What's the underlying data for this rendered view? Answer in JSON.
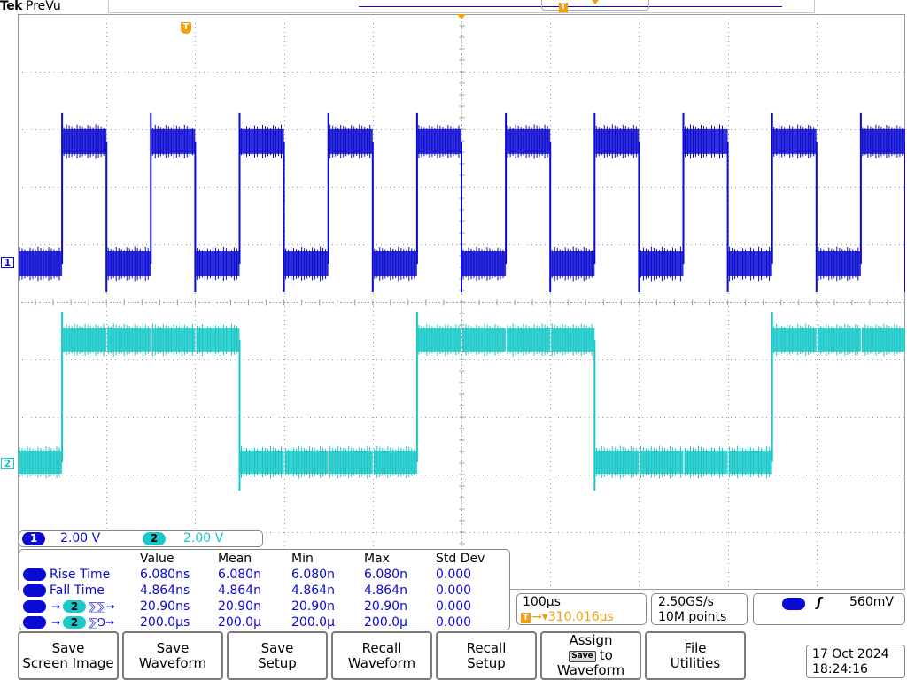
{
  "header": {
    "brand": "Tek",
    "mode": "PreVu"
  },
  "markers": {
    "trigger_glyph": "T",
    "ch1_ground": "1",
    "ch2_ground": "2"
  },
  "colors": {
    "ch1": "#0a0ad2",
    "ch2": "#19c8c8",
    "trigger": "#f0a010",
    "grid": "#9a9a9a"
  },
  "channels": [
    {
      "label": "1",
      "scale": "2.00 V"
    },
    {
      "label": "2",
      "scale": "2.00 V"
    }
  ],
  "measurements": {
    "headers": [
      "Value",
      "Mean",
      "Min",
      "Max",
      "Std Dev"
    ],
    "rows": [
      {
        "name": "Rise Time",
        "value": "6.080ns",
        "mean": "6.080n",
        "min": "6.080n",
        "max": "6.080n",
        "std": "0.000"
      },
      {
        "name": "Fall Time",
        "value": "4.864ns",
        "mean": "4.864n",
        "min": "4.864n",
        "max": "4.864n",
        "std": "0.000"
      },
      {
        "name": "Delay 1→2 (rising→rising)",
        "src": "1",
        "dst": "2",
        "arrow": "→",
        "edge": "⅀⅀→",
        "value": "20.90ns",
        "mean": "20.90n",
        "min": "20.90n",
        "max": "20.90n",
        "std": "0.000"
      },
      {
        "name": "Delay 1→2 (rising→falling)",
        "src": "1",
        "dst": "2",
        "arrow": "→",
        "edge": "⅀⅁→",
        "value": "200.0µs",
        "mean": "200.0µ",
        "min": "200.0µ",
        "max": "200.0µ",
        "std": "0.000"
      }
    ]
  },
  "horizontal": {
    "time_per_div": "100µs",
    "trigger_position": "→▾310.016µs"
  },
  "acquisition": {
    "sample_rate": "2.50GS/s",
    "record_length": "10M points"
  },
  "trigger": {
    "source": "1",
    "edge_symbol": "ʃ",
    "level": "560mV"
  },
  "menu": [
    {
      "id": "save-screen-image",
      "line1": "Save",
      "line2": "Screen Image"
    },
    {
      "id": "save-waveform",
      "line1": "Save",
      "line2": "Waveform"
    },
    {
      "id": "save-setup",
      "line1": "Save",
      "line2": "Setup"
    },
    {
      "id": "recall-waveform",
      "line1": "Recall",
      "line2": "Waveform"
    },
    {
      "id": "recall-setup",
      "line1": "Recall",
      "line2": "Setup"
    },
    {
      "id": "assign-save",
      "line1": "Assign",
      "chip": "Save",
      "line2": "to",
      "line3": "Waveform"
    },
    {
      "id": "file-utilities",
      "line1": "File",
      "line2": "Utilities"
    }
  ],
  "datetime": {
    "date": "17 Oct  2024",
    "time": "18:24:16"
  },
  "chart_data": {
    "type": "line",
    "title": "",
    "xlabel": "",
    "ylabel": "",
    "grid": true,
    "x_unit": "µs",
    "x": [
      -500,
      -450,
      -400,
      -350,
      -300,
      -250,
      -200,
      -150,
      -100,
      -50,
      0,
      50,
      100,
      150,
      200,
      250,
      300,
      350,
      400,
      450,
      500
    ],
    "series": [
      {
        "name": "1",
        "unit": "V",
        "values": [
          0,
          5,
          0,
          5,
          0,
          5,
          0,
          5,
          0,
          5,
          0,
          5,
          0,
          5,
          0,
          5,
          0,
          5,
          0,
          5,
          0
        ]
      },
      {
        "name": "2",
        "unit": "V",
        "values": [
          0,
          5,
          5,
          5,
          5,
          0,
          0,
          0,
          0,
          5,
          5,
          5,
          5,
          0,
          0,
          0,
          0,
          5,
          5,
          5,
          5
        ]
      }
    ],
    "xlim": [
      -500,
      500
    ],
    "ylim_divs": [
      -5,
      5
    ]
  }
}
